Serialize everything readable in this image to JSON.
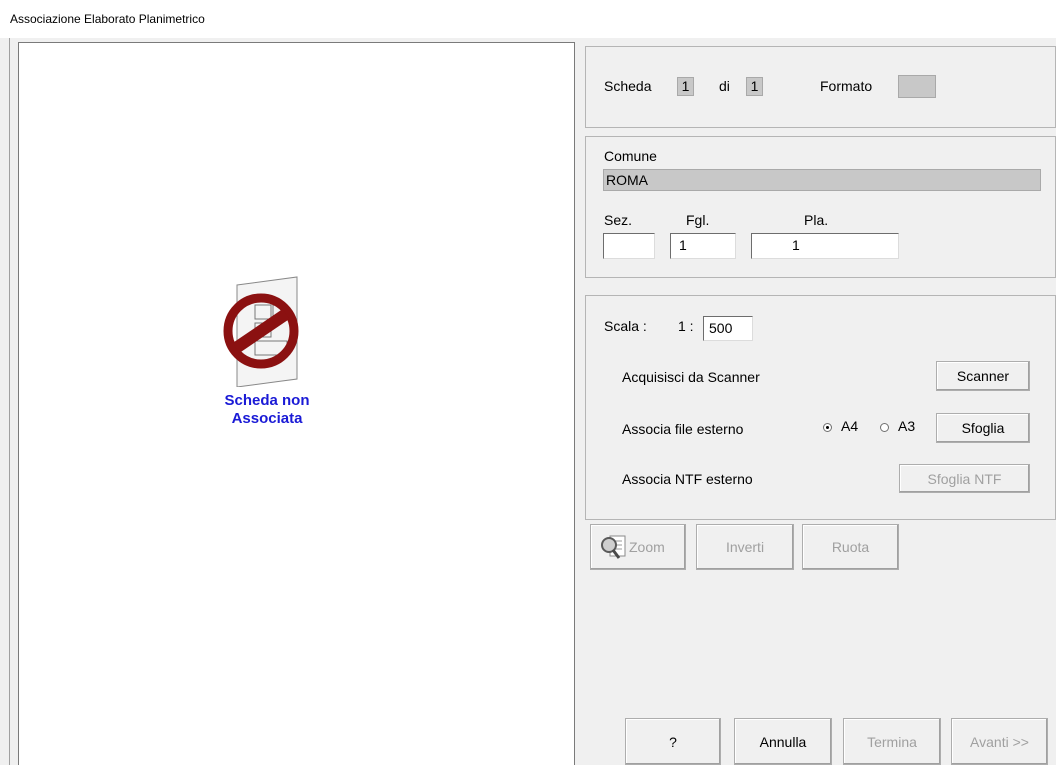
{
  "window": {
    "title": "Associazione Elaborato Planimetrico"
  },
  "preview": {
    "line1": "Scheda non",
    "line2": "Associata",
    "icon": "no-entry-document-icon"
  },
  "scheda": {
    "label": "Scheda",
    "current": "1",
    "of_label": "di",
    "total": "1",
    "format_label": "Formato",
    "format_value": ""
  },
  "location": {
    "comune_label": "Comune",
    "comune_value": "ROMA",
    "sez_label": "Sez.",
    "sez_value": "",
    "fgl_label": "Fgl.",
    "fgl_value": "1",
    "pla_label": "Pla.",
    "pla_value": "1"
  },
  "acquisition": {
    "scala_label": "Scala :",
    "scala_prefix": "1 :",
    "scala_value": "500",
    "scanner_label": "Acquisisci da Scanner",
    "scanner_button": "Scanner",
    "file_label": "Associa file esterno",
    "radio_a4": "A4",
    "radio_a3": "A3",
    "selected_format": "A4",
    "browse_button": "Sfoglia",
    "ntf_label": "Associa NTF esterno",
    "ntf_button": "Sfoglia NTF"
  },
  "tools": {
    "zoom": "Zoom",
    "invert": "Inverti",
    "rotate": "Ruota",
    "zoom_icon": "magnifier-document-icon"
  },
  "footer": {
    "help": "?",
    "cancel": "Annulla",
    "finish": "Termina",
    "next": "Avanti >>"
  }
}
